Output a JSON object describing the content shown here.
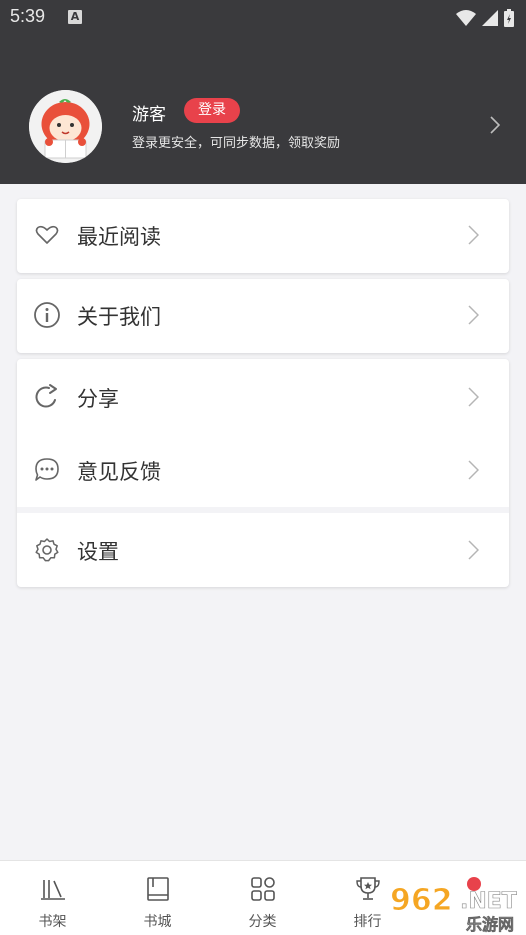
{
  "status_bar": {
    "time": "5:39",
    "badge": "A"
  },
  "profile": {
    "username": "游客",
    "login_label": "登录",
    "subtitle": "登录更安全，可同步数据，领取奖励"
  },
  "menu": {
    "recent": "最近阅读",
    "about": "关于我们",
    "share": "分享",
    "feedback": "意见反馈",
    "settings": "设置"
  },
  "tabs": {
    "bookshelf": "书架",
    "bookstore": "书城",
    "category": "分类",
    "ranking": "排行"
  },
  "watermark": {
    "brand": "962",
    "suffix": ".NET",
    "sub": "乐游网"
  },
  "colors": {
    "header_bg": "#3a3a3d",
    "accent": "#e8424b",
    "page_bg": "#f3f3f6"
  }
}
